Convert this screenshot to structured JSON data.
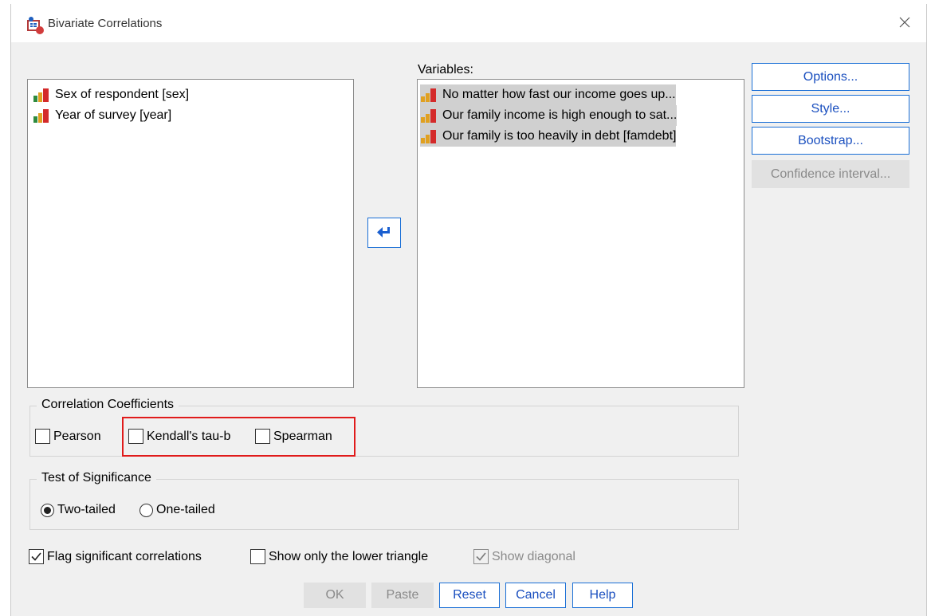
{
  "window": {
    "title": "Bivariate Correlations",
    "icon": "spss-dialog-icon",
    "close_icon": "close-icon"
  },
  "source_list": {
    "items": [
      {
        "label": "Sex of respondent [sex]",
        "icon": "nominal-variable-icon"
      },
      {
        "label": "Year of survey [year]",
        "icon": "nominal-variable-icon"
      }
    ]
  },
  "move_button": {
    "icon": "arrow-left-icon"
  },
  "variables": {
    "label": "Variables:",
    "items": [
      {
        "label": "No matter how fast our income goes up...",
        "icon": "ordinal-variable-icon"
      },
      {
        "label": "Our family income is high enough to sat...",
        "icon": "ordinal-variable-icon"
      },
      {
        "label": "Our family is too heavily in debt [famdebt]",
        "icon": "ordinal-variable-icon"
      }
    ]
  },
  "side_buttons": {
    "options": "Options...",
    "style": "Style...",
    "bootstrap": "Bootstrap...",
    "confidence_interval": "Confidence interval..."
  },
  "correlation_coefficients": {
    "title": "Correlation Coefficients",
    "pearson": {
      "label": "Pearson",
      "checked": false
    },
    "kendall": {
      "label": "Kendall's tau-b",
      "checked": false
    },
    "spearman": {
      "label": "Spearman",
      "checked": false
    }
  },
  "test_of_significance": {
    "title": "Test of Significance",
    "two_tailed": {
      "label": "Two-tailed",
      "selected": true
    },
    "one_tailed": {
      "label": "One-tailed",
      "selected": false
    }
  },
  "flags": {
    "flag_significant": {
      "label": "Flag significant correlations",
      "checked": true
    },
    "lower_triangle": {
      "label": "Show only the lower triangle",
      "checked": false
    },
    "show_diagonal": {
      "label": "Show diagonal",
      "checked": true,
      "disabled": true
    }
  },
  "bottom_buttons": {
    "ok": "OK",
    "paste": "Paste",
    "reset": "Reset",
    "cancel": "Cancel",
    "help": "Help"
  },
  "colors": {
    "accent": "#1a6fd6",
    "highlight": "#e01b1b",
    "dialog_bg": "#f0f0f0",
    "selection": "#d0d0d0"
  }
}
